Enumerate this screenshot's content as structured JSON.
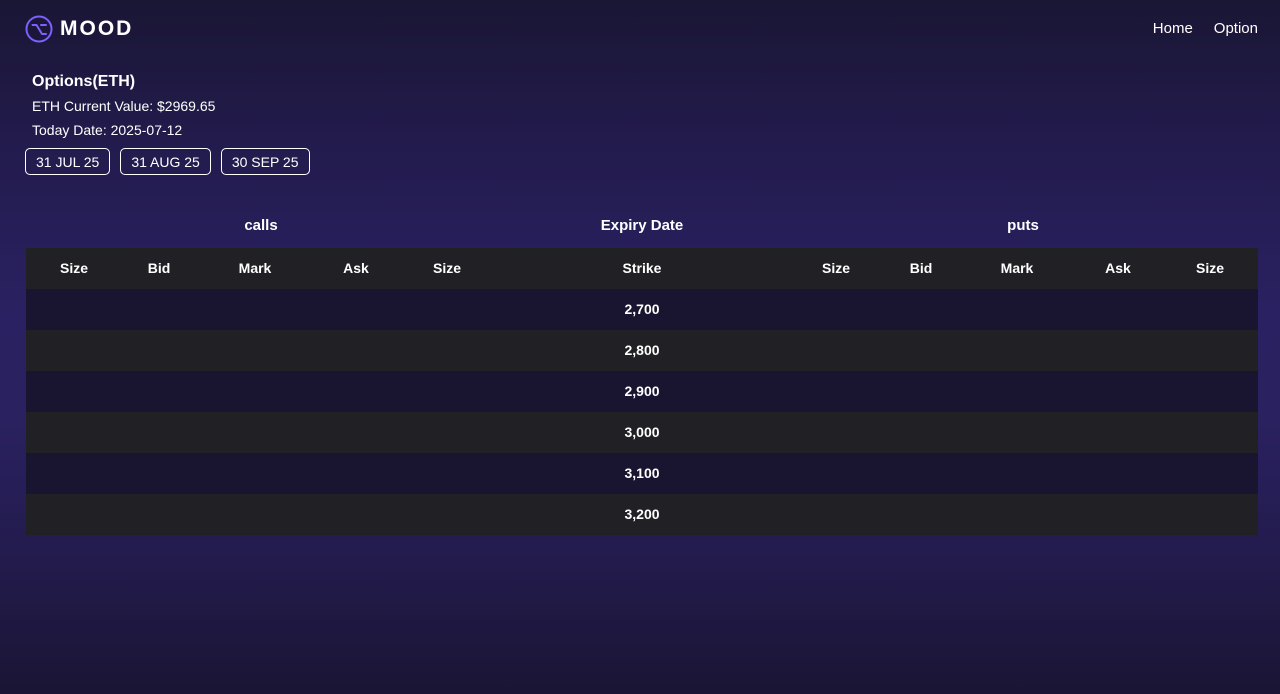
{
  "brand": {
    "name": "MOOD"
  },
  "nav": {
    "home": "Home",
    "option": "Option"
  },
  "info": {
    "title": "Options(ETH)",
    "current_value": "ETH Current Value: $2969.65",
    "today_date": "Today Date: 2025-07-12"
  },
  "expiries": [
    "31 JUL 25",
    "31 AUG 25",
    "30 SEP 25"
  ],
  "sections": {
    "calls": "calls",
    "expiry": "Expiry Date",
    "puts": "puts"
  },
  "columns": {
    "calls": [
      "Size",
      "Bid",
      "Mark",
      "Ask",
      "Size"
    ],
    "strike": "Strike",
    "puts": [
      "Size",
      "Bid",
      "Mark",
      "Ask",
      "Size"
    ]
  },
  "strikes": [
    "2,700",
    "2,800",
    "2,900",
    "3,000",
    "3,100",
    "3,200"
  ],
  "colors": {
    "accent": "#7b61ff",
    "row_dark": "#19142f",
    "row_grey": "#212125"
  }
}
